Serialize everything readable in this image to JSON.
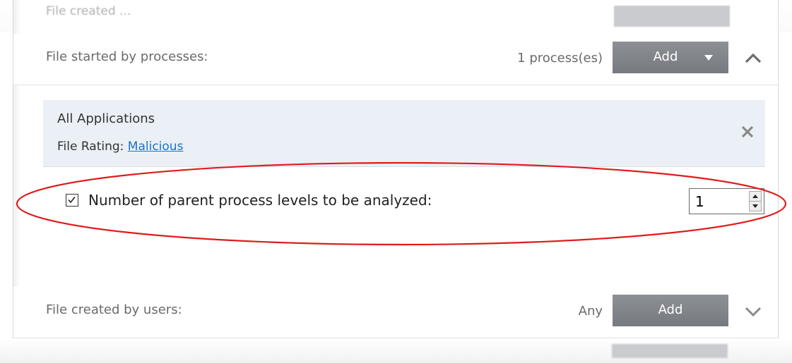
{
  "faded_row_above": {
    "label": "File created ..."
  },
  "process_row": {
    "label": "File started by processes:",
    "count": "1 process(es)",
    "add_label": "Add"
  },
  "application_entry": {
    "name": "All Applications",
    "rating_prefix": "File Rating: ",
    "rating_value": "Malicious"
  },
  "parent_levels_option": {
    "checked": true,
    "label": "Number of parent process levels to be analyzed:",
    "value": "1"
  },
  "users_row": {
    "label": "File created by users:",
    "count": "Any",
    "add_label": "Add"
  },
  "colors": {
    "highlight": "#e01b1b",
    "link": "#1a73c9",
    "button": "#80848a",
    "entry_background": "#eaf0f5"
  },
  "icons": [
    "chevron-up-icon",
    "chevron-down-icon",
    "close-icon",
    "checkbox-checked-icon",
    "spinner-up-icon",
    "spinner-down-icon",
    "dropdown-caret-icon"
  ]
}
